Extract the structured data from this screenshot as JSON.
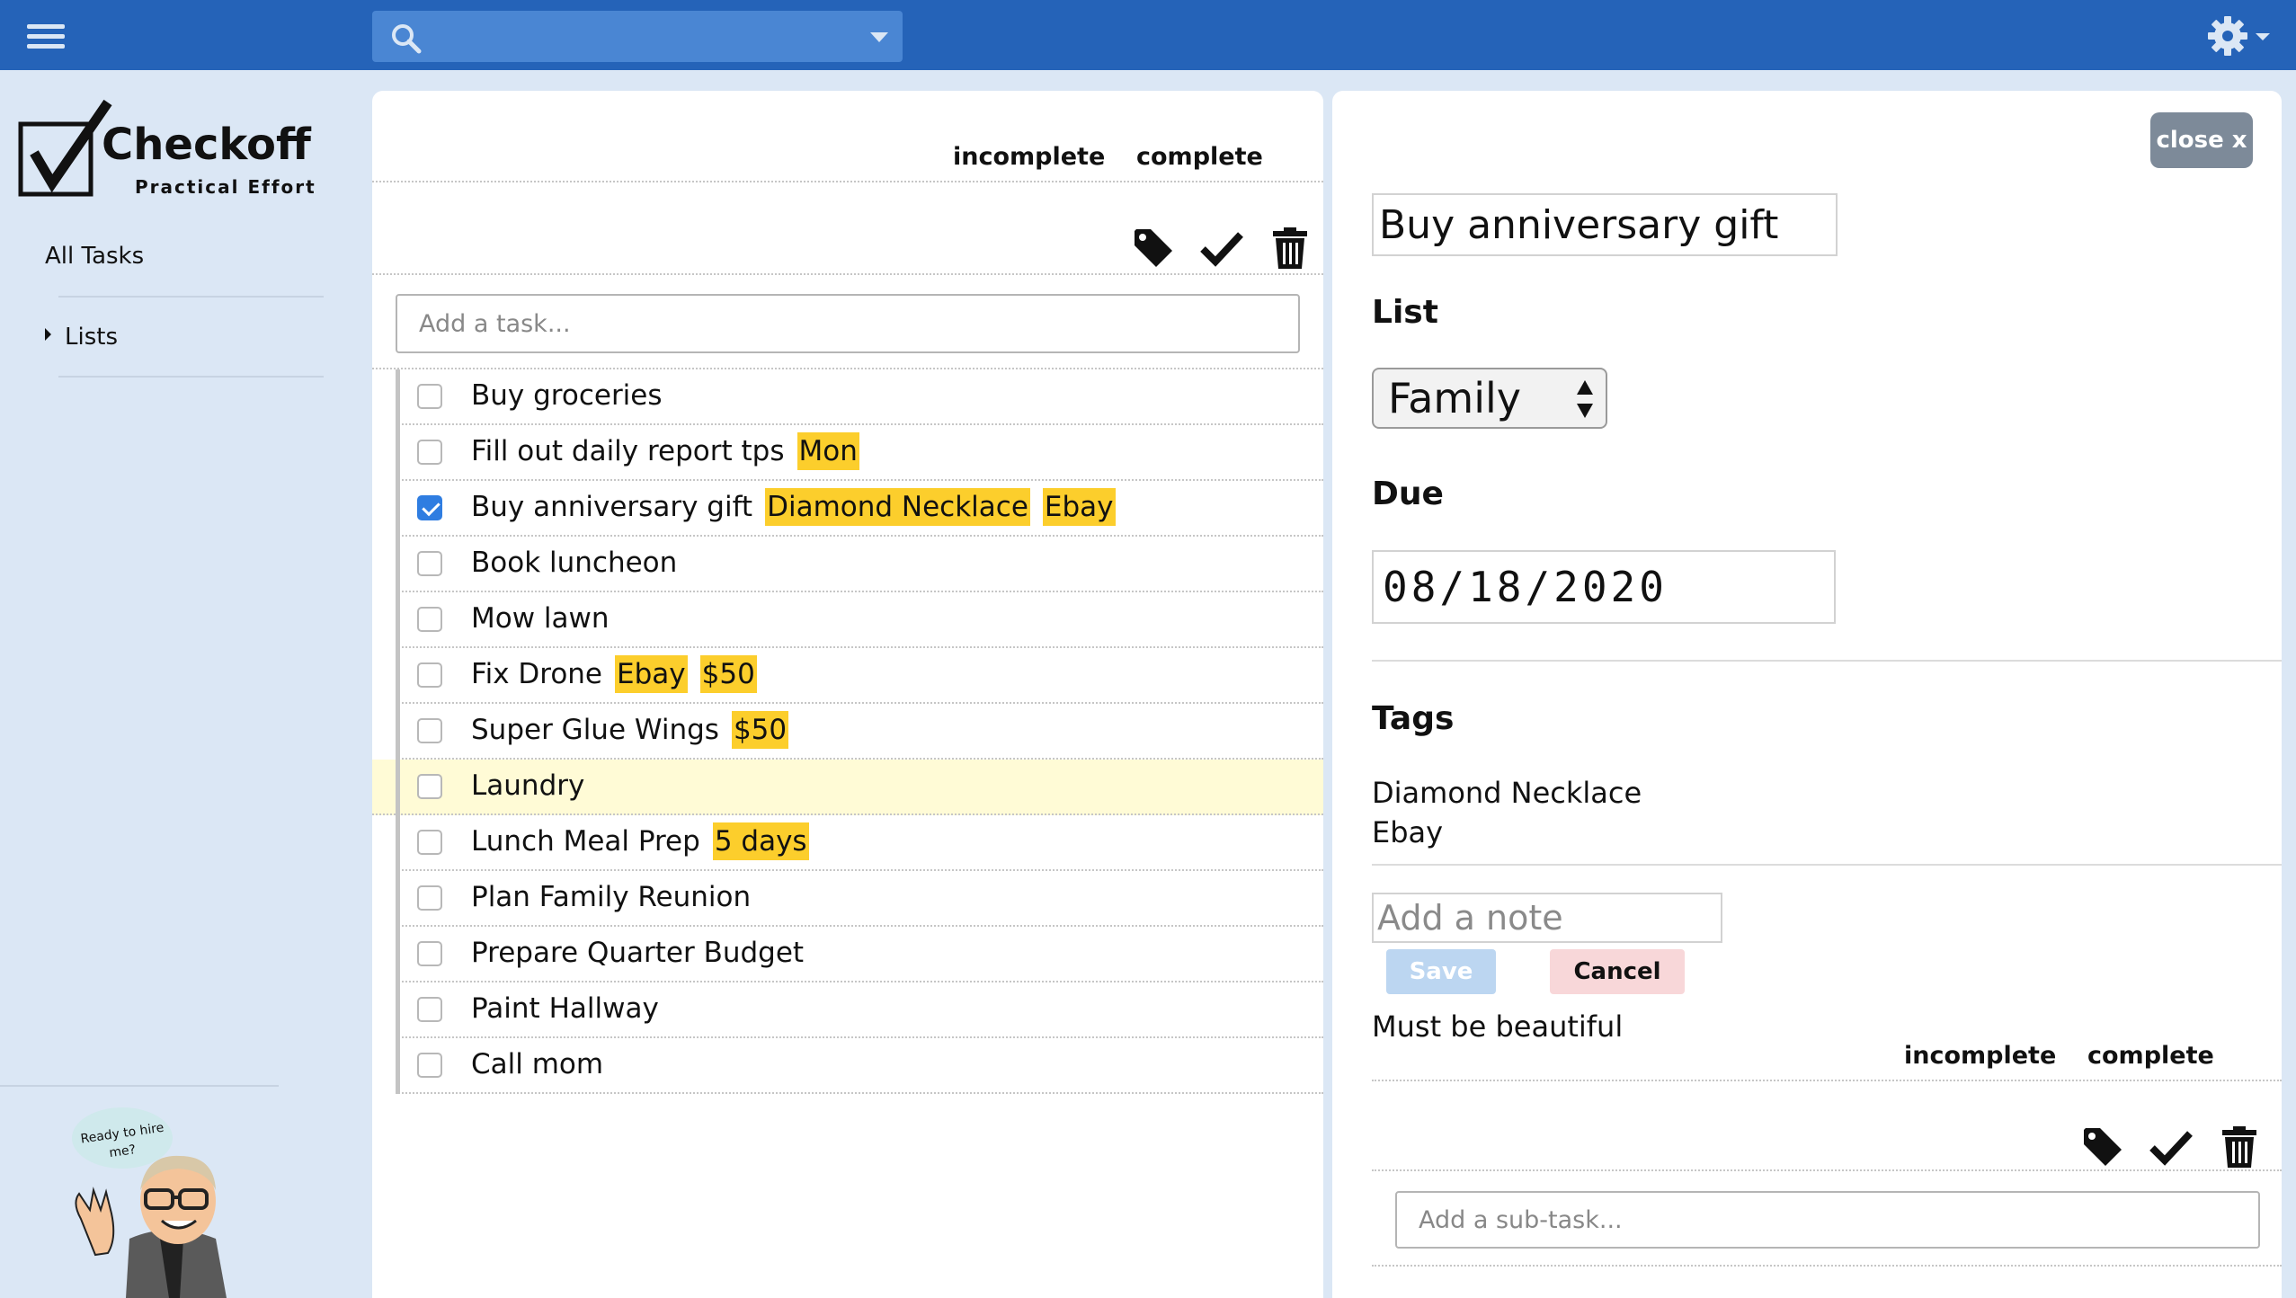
{
  "topbar": {
    "search_placeholder": ""
  },
  "brand": {
    "name": "Checkoff",
    "tagline": "Practical Effort"
  },
  "sidebar": {
    "all_tasks": "All Tasks",
    "lists": "Lists",
    "avatar_caption_line1": "Ready to hire",
    "avatar_caption_line2": "me?"
  },
  "task_list": {
    "filter_incomplete": "incomplete",
    "filter_complete": "complete",
    "add_placeholder": "Add a task...",
    "tasks": [
      {
        "title": "Buy groceries",
        "checked": false,
        "tags": []
      },
      {
        "title": "Fill out daily report tps",
        "checked": false,
        "tags": [
          "Mon"
        ]
      },
      {
        "title": "Buy anniversary gift",
        "checked": true,
        "tags": [
          "Diamond Necklace",
          "Ebay"
        ]
      },
      {
        "title": "Book luncheon",
        "checked": false,
        "tags": []
      },
      {
        "title": "Mow lawn",
        "checked": false,
        "tags": []
      },
      {
        "title": "Fix Drone",
        "checked": false,
        "tags": [
          "Ebay",
          "$50"
        ]
      },
      {
        "title": "Super Glue Wings",
        "checked": false,
        "tags": [
          "$50"
        ]
      },
      {
        "title": "Laundry",
        "checked": false,
        "tags": [],
        "highlighted": true
      },
      {
        "title": "Lunch Meal Prep",
        "checked": false,
        "tags": [
          "5 days"
        ]
      },
      {
        "title": "Plan Family Reunion",
        "checked": false,
        "tags": []
      },
      {
        "title": "Prepare Quarter Budget",
        "checked": false,
        "tags": []
      },
      {
        "title": "Paint Hallway",
        "checked": false,
        "tags": []
      },
      {
        "title": "Call mom",
        "checked": false,
        "tags": []
      }
    ]
  },
  "detail": {
    "close_label": "close x",
    "title_value": "Buy anniversary gift",
    "list_label": "List",
    "list_value": "Family",
    "due_label": "Due",
    "due_value": "08/18/2020",
    "tags_label": "Tags",
    "tags": [
      "Diamond Necklace",
      "Ebay"
    ],
    "note_placeholder": "Add a note",
    "save_label": "Save",
    "cancel_label": "Cancel",
    "note_text": "Must be beautiful",
    "filter_incomplete": "incomplete",
    "filter_complete": "complete",
    "subtask_placeholder": "Add a sub-task..."
  },
  "colors": {
    "topbar": "#2563b8",
    "sidebar_bg": "#dbe7f5",
    "tag_bg": "#fcce2c",
    "checkbox_checked": "#2f7de1",
    "highlight_row": "#fffbd6"
  },
  "icons": [
    "menu-icon",
    "search-icon",
    "dropdown-caret-icon",
    "gear-icon",
    "tag-icon",
    "checkmark-icon",
    "trash-icon"
  ]
}
